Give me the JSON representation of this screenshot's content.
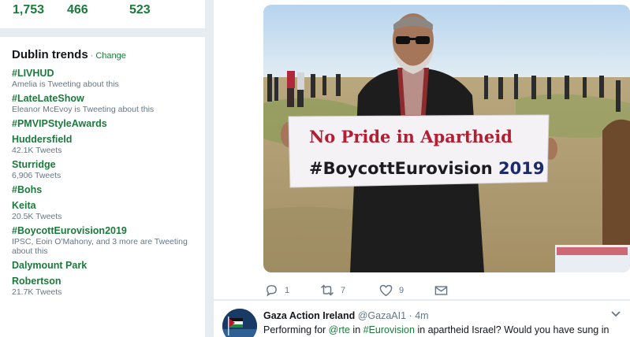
{
  "profile_stats": {
    "tweets": "1,753",
    "following": "466",
    "followers": "523"
  },
  "trends": {
    "title": "Dublin trends",
    "separator": "·",
    "change_label": "Change",
    "items": [
      {
        "name": "#LIVHUD",
        "sub": "Amelia is Tweeting about this"
      },
      {
        "name": "#LateLateShow",
        "sub": "Eleanor McEvoy is Tweeting about this"
      },
      {
        "name": "#PMVIPStyleAwards",
        "sub": ""
      },
      {
        "name": "Huddersfield",
        "sub": "42.1K Tweets"
      },
      {
        "name": "Sturridge",
        "sub": "6,906 Tweets"
      },
      {
        "name": "#Bohs",
        "sub": ""
      },
      {
        "name": "Keita",
        "sub": "20.5K Tweets"
      },
      {
        "name": "#BoycottEurovision2019",
        "sub": "IPSC, Eoin O'Mahony, and 3 more are Tweeting about this"
      },
      {
        "name": "Dalymount Park",
        "sub": ""
      },
      {
        "name": "Robertson",
        "sub": "21.7K Tweets"
      }
    ]
  },
  "tweet": {
    "media": {
      "sign_line1_a": "No Pride in ",
      "sign_line1_b": "Apartheid",
      "sign_line2_a": "#BoycottEurovision ",
      "sign_line2_b": "2019"
    },
    "actions": {
      "replies": "1",
      "retweets": "7",
      "likes": "9"
    }
  },
  "next_tweet": {
    "name": "Gaza Action Ireland",
    "handle": "@GazaAI1",
    "dot": "·",
    "time": "4m",
    "text_1": "Performing for ",
    "mention": "@rte",
    "text_2": " in ",
    "hashtag": "#Eurovision",
    "text_3": " in apartheid Israel? Would you have sung in"
  },
  "colors": {
    "accent": "#1b7a3c",
    "muted": "#657786",
    "background": "#e6ecf0"
  }
}
